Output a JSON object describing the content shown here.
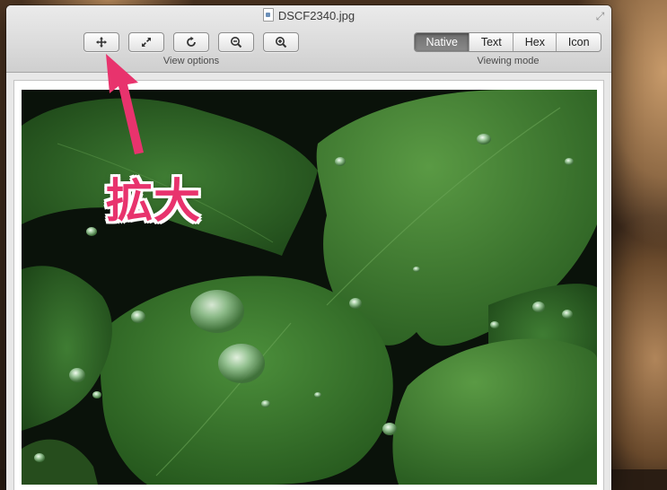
{
  "window": {
    "title": "DSCF2340.jpg"
  },
  "toolbar": {
    "buttons": [
      {
        "icon": "move-arrows-icon"
      },
      {
        "icon": "expand-icon"
      },
      {
        "icon": "rotate-icon"
      },
      {
        "icon": "zoom-out-icon"
      },
      {
        "icon": "zoom-in-icon"
      }
    ],
    "view_options_label": "View options",
    "viewing_mode_label": "Viewing mode",
    "modes": [
      "Native",
      "Text",
      "Hex",
      "Icon"
    ],
    "active_mode": "Native"
  },
  "annotation": {
    "text": "拡大",
    "color": "#e8336d"
  },
  "photo": {
    "subject": "green leaves with water droplets"
  }
}
